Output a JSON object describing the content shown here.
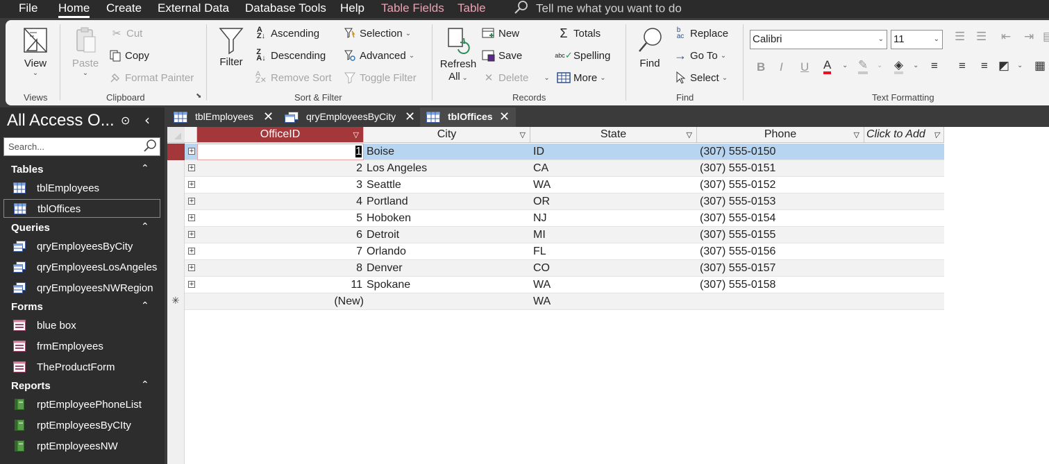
{
  "menu": {
    "file": "File",
    "home": "Home",
    "create": "Create",
    "external_data": "External Data",
    "database_tools": "Database Tools",
    "help": "Help",
    "table_fields": "Table Fields",
    "table": "Table",
    "tell_me": "Tell me what you want to do"
  },
  "ribbon": {
    "views": {
      "view": "View",
      "label": "Views"
    },
    "clipboard": {
      "paste": "Paste",
      "cut": "Cut",
      "copy": "Copy",
      "format_painter": "Format Painter",
      "label": "Clipboard"
    },
    "sort_filter": {
      "filter": "Filter",
      "ascending": "Ascending",
      "descending": "Descending",
      "remove_sort": "Remove Sort",
      "selection": "Selection",
      "advanced": "Advanced",
      "toggle_filter": "Toggle Filter",
      "label": "Sort & Filter"
    },
    "records": {
      "refresh": "Refresh",
      "refresh_all": "All",
      "new": "New",
      "save": "Save",
      "delete": "Delete",
      "totals": "Totals",
      "spelling": "Spelling",
      "more": "More",
      "label": "Records"
    },
    "find": {
      "find": "Find",
      "replace": "Replace",
      "goto": "Go To",
      "select": "Select",
      "label": "Find"
    },
    "text_formatting": {
      "font": "Calibri",
      "size": "11",
      "label": "Text Formatting"
    }
  },
  "nav": {
    "title": "All Access O...",
    "search_placeholder": "Search...",
    "sections": [
      {
        "name": "Tables",
        "items": [
          "tblEmployees",
          "tblOffices"
        ]
      },
      {
        "name": "Queries",
        "items": [
          "qryEmployeesByCity",
          "qryEmployeesLosAngeles",
          "qryEmployeesNWRegion"
        ]
      },
      {
        "name": "Forms",
        "items": [
          "blue box",
          "frmEmployees",
          "TheProductForm"
        ]
      },
      {
        "name": "Reports",
        "items": [
          "rptEmployeePhoneList",
          "rptEmployeesByCIty",
          "rptEmployeesNW"
        ]
      }
    ]
  },
  "tabs": [
    "tblEmployees",
    "qryEmployeesByCity",
    "tblOffices"
  ],
  "table": {
    "columns": [
      "OfficeID",
      "City",
      "State",
      "Phone",
      "Click to Add"
    ],
    "rows": [
      [
        "1",
        "Boise",
        "ID",
        "(307) 555-0150"
      ],
      [
        "2",
        "Los Angeles",
        "CA",
        "(307) 555-0151"
      ],
      [
        "3",
        "Seattle",
        "WA",
        "(307) 555-0152"
      ],
      [
        "4",
        "Portland",
        "OR",
        "(307) 555-0153"
      ],
      [
        "5",
        "Hoboken",
        "NJ",
        "(307) 555-0154"
      ],
      [
        "6",
        "Detroit",
        "MI",
        "(307) 555-0155"
      ],
      [
        "7",
        "Orlando",
        "FL",
        "(307) 555-0156"
      ],
      [
        "8",
        "Denver",
        "CO",
        "(307) 555-0157"
      ],
      [
        "11",
        "Spokane",
        "WA",
        "(307) 555-0158"
      ]
    ],
    "new_row": {
      "id": "(New)",
      "state": "WA"
    }
  },
  "colors": {
    "accent": "#a4373a",
    "selected_row": "#b7d5f1",
    "ribbon_bg": "#f3f3f3",
    "nav_bg": "#2d2d2d"
  }
}
